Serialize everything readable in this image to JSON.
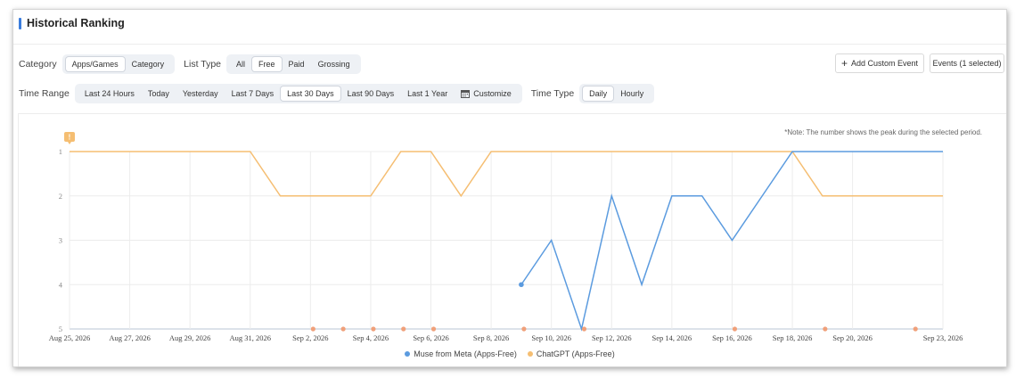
{
  "panel": {
    "title": "Historical Ranking"
  },
  "filters": {
    "category_label": "Category",
    "category_options": [
      "Apps/Games",
      "Category"
    ],
    "category_selected": 0,
    "list_type_label": "List Type",
    "list_type_options": [
      "All",
      "Free",
      "Paid",
      "Grossing"
    ],
    "list_type_selected": 1,
    "time_range_label": "Time Range",
    "time_range_options": [
      "Last 24 Hours",
      "Today",
      "Yesterday",
      "Last 7 Days",
      "Last 30 Days",
      "Last 90 Days",
      "Last 1 Year"
    ],
    "time_range_selected": 4,
    "customize_label": "Customize",
    "time_type_label": "Time Type",
    "time_type_options": [
      "Daily",
      "Hourly"
    ],
    "time_type_selected": 0
  },
  "actions": {
    "add_event_label": "Add Custom Event",
    "events_label": "Events (1 selected)"
  },
  "chart_data": {
    "type": "line",
    "note": "*Note: The number shows the peak during the selected period.",
    "x": [
      "Aug 25",
      "Aug 26",
      "Aug 27",
      "Aug 28",
      "Aug 29",
      "Aug 30",
      "Aug 31",
      "Sep 1",
      "Sep 2",
      "Sep 3",
      "Sep 4",
      "Sep 5",
      "Sep 6",
      "Sep 7",
      "Sep 8",
      "Sep 9",
      "Sep 10",
      "Sep 11",
      "Sep 12",
      "Sep 13",
      "Sep 14",
      "Sep 15",
      "Sep 16",
      "Sep 17",
      "Sep 18",
      "Sep 19",
      "Sep 20",
      "Sep 21",
      "Sep 22",
      "Sep 23"
    ],
    "xticks": [
      "Aug 25, 2026",
      "Aug 27, 2026",
      "Aug 29, 2026",
      "Aug 31, 2026",
      "Sep 2, 2026",
      "Sep 4, 2026",
      "Sep 6, 2026",
      "Sep 8, 2026",
      "Sep 10, 2026",
      "Sep 12, 2026",
      "Sep 14, 2026",
      "Sep 16, 2026",
      "Sep 18, 2026",
      "Sep 20, 2026",
      "Sep 23, 2026"
    ],
    "yticks": [
      "1",
      "2",
      "3",
      "4",
      "5"
    ],
    "ylim": [
      1,
      5
    ],
    "y_reversed": true,
    "series": [
      {
        "name": "Muse from Meta (Apps-Free)",
        "color": "#5b9bdf",
        "values": [
          null,
          null,
          null,
          null,
          null,
          null,
          null,
          null,
          null,
          null,
          null,
          null,
          null,
          null,
          null,
          4,
          3,
          5,
          2,
          4,
          2,
          2,
          3,
          2,
          1,
          1,
          1,
          1,
          1,
          1
        ]
      },
      {
        "name": "ChatGPT (Apps-Free)",
        "color": "#f5be72",
        "values": [
          1,
          1,
          1,
          1,
          1,
          1,
          1,
          2,
          2,
          2,
          2,
          1,
          1,
          2,
          1,
          1,
          1,
          1,
          1,
          1,
          1,
          1,
          1,
          1,
          1,
          2,
          2,
          2,
          2,
          2
        ]
      }
    ],
    "event_markers": [
      "Sep 2",
      "Sep 3",
      "Sep 4",
      "Sep 5",
      "Sep 6",
      "Sep 9",
      "Sep 11",
      "Sep 16",
      "Sep 19",
      "Sep 22"
    ],
    "event_marker_color": "#f0a07a",
    "flag_color": "#f5be72",
    "grid": true
  }
}
